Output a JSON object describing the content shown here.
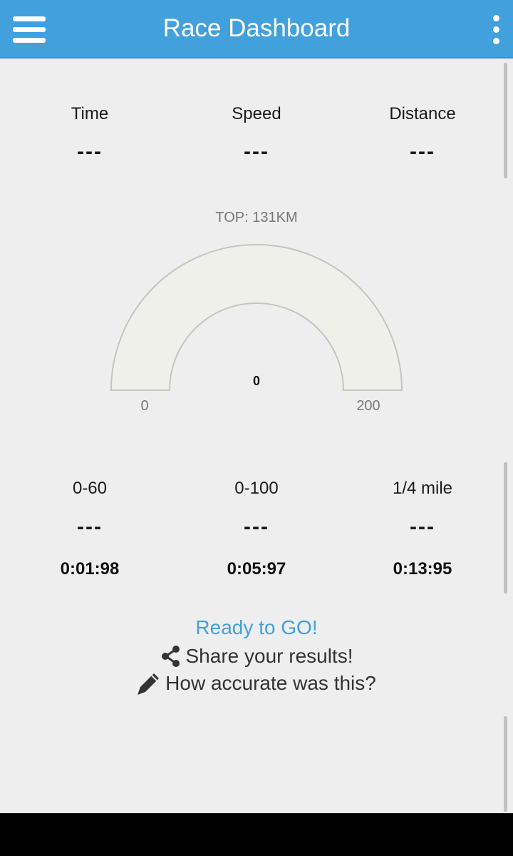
{
  "appbar": {
    "title": "Race Dashboard",
    "menu_icon": "hamburger-menu-icon",
    "overflow_icon": "more-vertical-icon"
  },
  "stats": [
    {
      "label": "Time",
      "value": "---"
    },
    {
      "label": "Speed",
      "value": "---"
    },
    {
      "label": "Distance",
      "value": "---"
    }
  ],
  "gauge": {
    "top_speed": "TOP: 131KM",
    "current": 0,
    "current_label": "0",
    "min": 0,
    "min_label": "0",
    "max": 200,
    "max_label": "200"
  },
  "benchmarks": [
    {
      "label": "0-60",
      "value": "---",
      "best": "0:01:98"
    },
    {
      "label": "0-100",
      "value": "---",
      "best": "0:05:97"
    },
    {
      "label": "1/4 mile",
      "value": "---",
      "best": "0:13:95"
    }
  ],
  "status": "Ready to GO!",
  "actions": {
    "share": {
      "label": "Share your results!",
      "icon": "share-icon"
    },
    "feedback": {
      "label": "How accurate was this?",
      "icon": "pencil-icon"
    }
  },
  "colors": {
    "accent": "#42a0dc",
    "background": "#eeeeee",
    "gauge_fill": "#f0f0eb",
    "gauge_stroke": "#c4c4c4"
  }
}
